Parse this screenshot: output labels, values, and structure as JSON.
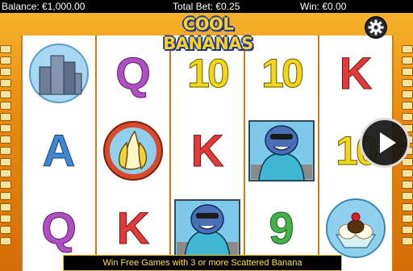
{
  "status_bar": {
    "balance": "Balance: €1,000.00",
    "total_bet": "Total Bet: €0.25",
    "win": "Win: €0.00"
  },
  "logo": {
    "text": "COOL BANANAS"
  },
  "reels": [
    [
      "city",
      "A",
      "Q"
    ],
    [
      "Q",
      "banana",
      "K"
    ],
    [
      "10",
      "K",
      "gorilla"
    ],
    [
      "10",
      "gorilla",
      "9"
    ],
    [
      "K",
      "10",
      "sundae"
    ]
  ],
  "message": "Win Free Games with 3 or more Scattered Banana",
  "icons": {
    "settings": "gear-icon",
    "play": "play-icon"
  },
  "colors": {
    "frame": "#e98a12",
    "message_text": "#ffe24a",
    "status_bg": "#000000"
  }
}
